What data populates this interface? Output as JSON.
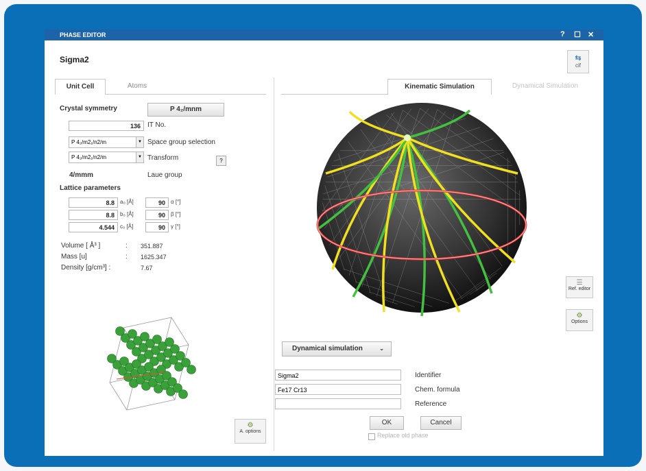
{
  "window": {
    "title": "PHASE EDITOR",
    "controls": [
      "?",
      "☐",
      "✕"
    ],
    "phase_name": "Sigma2",
    "cif_button_label": "cif"
  },
  "left_tabs": [
    {
      "label": "Unit Cell",
      "active": true
    },
    {
      "label": "Atoms",
      "active": false
    }
  ],
  "right_tabs": [
    {
      "label": "Kinematic Simulation",
      "active": true
    },
    {
      "label": "Dynamical Simulation",
      "active": false
    }
  ],
  "symmetry": {
    "header": "Crystal symmetry",
    "space_group_button": "P 4₂/mnm",
    "it_no_value": "136",
    "it_no_label": "IT No.",
    "space_group_selection_value": "P 4₂/m2₁/n2/m",
    "space_group_selection_label": "Space group selection",
    "transform_value": "P 4₂/m2₁/n2/m",
    "transform_label": "Transform",
    "transform_help": "?",
    "laue_value": "4/mmm",
    "laue_label": "Laue group"
  },
  "lattice": {
    "header": "Lattice parameters",
    "rows": [
      {
        "len": "8.8",
        "len_unit": "a₀ [Å]",
        "ang": "90",
        "ang_unit": "α [°]"
      },
      {
        "len": "8.8",
        "len_unit": "b₀ [Å]",
        "ang": "90",
        "ang_unit": "β [°]"
      },
      {
        "len": "4.544",
        "len_unit": "c₀ [Å]",
        "ang": "90",
        "ang_unit": "γ [°]"
      }
    ]
  },
  "properties": [
    {
      "label": "Volume [ Å³ ]",
      "sep": ":",
      "value": "351.887"
    },
    {
      "label": "Mass [u]",
      "sep": ":",
      "value": "1625.347"
    },
    {
      "label": "Density [g/cm³] :",
      "sep": "",
      "value": "7.67"
    }
  ],
  "a_options_label": "A. options",
  "ref_editor_label": "Ref. editor",
  "options_label": "Options",
  "simulation_dropdown": "Dynamical simulation",
  "form": [
    {
      "value": "Sigma2",
      "label": "Identifier"
    },
    {
      "value": "Fe17 Cr13",
      "label": "Chem. formula"
    },
    {
      "value": "",
      "label": "Reference"
    }
  ],
  "ok_label": "OK",
  "cancel_label": "Cancel",
  "replace_label": "Replace old phase",
  "colors": {
    "frame": "#0a6fb7",
    "titlebar": "#1d63a8",
    "atom": "#3aa03a",
    "band_yellow": "#f0e020",
    "band_green": "#44c040",
    "band_red": "#e83030"
  }
}
